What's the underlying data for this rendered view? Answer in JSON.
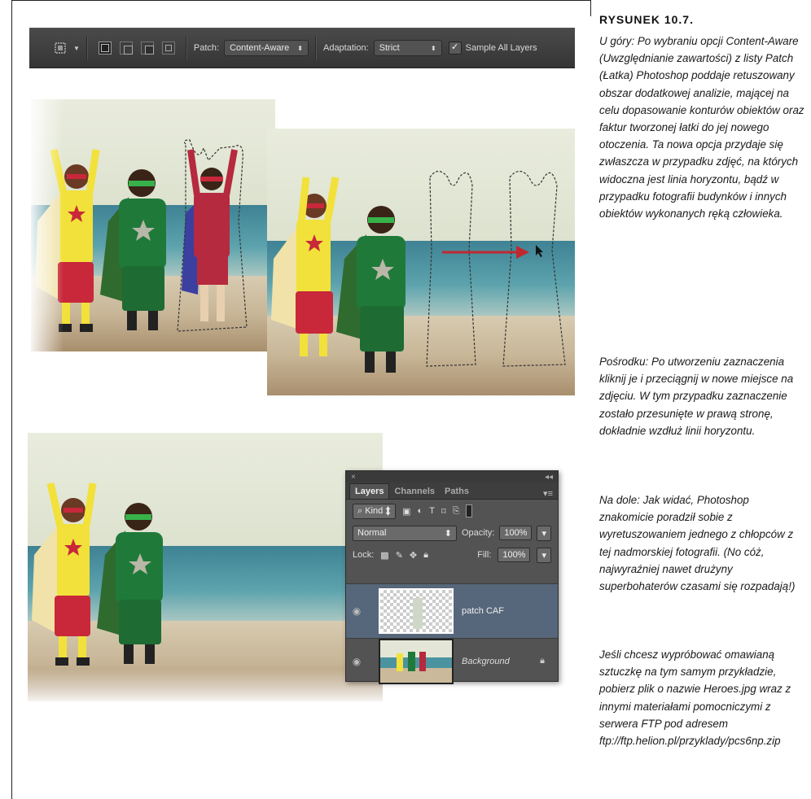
{
  "options_bar": {
    "tool_icon": "patch-tool-icon",
    "mode_icons": [
      "new-selection-icon",
      "add-to-selection-icon",
      "subtract-from-selection-icon",
      "intersect-selection-icon"
    ],
    "patch_label": "Patch:",
    "patch_value": "Content-Aware",
    "adaptation_label": "Adaptation:",
    "adaptation_value": "Strict",
    "sample_all_layers_label": "Sample All Layers",
    "sample_all_layers_checked": true
  },
  "layers_panel": {
    "close_glyph": "×",
    "collapse_glyph": "◂◂",
    "tabs": [
      "Layers",
      "Channels",
      "Paths"
    ],
    "filter_kind": "Kind",
    "blend_mode": "Normal",
    "opacity_label": "Opacity:",
    "opacity_value": "100%",
    "lock_label": "Lock:",
    "fill_label": "Fill:",
    "fill_value": "100%",
    "layers": [
      {
        "name": "patch CAF",
        "selected": true,
        "visible": true
      },
      {
        "name": "Background",
        "selected": false,
        "visible": true,
        "locked": true
      }
    ]
  },
  "caption": {
    "title": "RYSUNEK 10.7.",
    "paragraphs": [
      "U góry: Po wybraniu opcji Content-Aware (Uwzględnianie zawartości) z listy Patch (Łatka) Photoshop poddaje retuszowany obszar dodatkowej analizie, mającej na celu dopasowanie konturów obiektów oraz faktur tworzonej łatki do jej nowego otoczenia. Ta nowa opcja przydaje się zwłaszcza w przypadku zdjęć, na których widoczna jest linia horyzontu, bądź w przypadku fotografii budynków i innych obiektów wykonanych ręką człowieka.",
      "Pośrodku: Po utworzeniu zaznaczenia kliknij je i przeciągnij w nowe miejsce na zdjęciu. W tym przypadku zaznaczenie zostało przesunięte w prawą stronę, dokładnie wzdłuż linii horyzontu.",
      "Na dole: Jak widać, Photoshop znakomicie poradził sobie z wyretuszowaniem jednego z chłopców z tej nadmorskiej fotografii. (No cóż, najwyraźniej nawet drużyny superbohaterów czasami się rozpadają!)",
      "Jeśli chcesz wypróbować omawianą sztuczkę na tym samym przykładzie, pobierz plik o nazwie Heroes.jpg wraz z innymi materiałami pomocniczymi z serwera FTP pod adresem ftp://ftp.helion.pl/przyklady/pcs6np.zip"
    ]
  },
  "colors": {
    "arrow": "#c0282f",
    "panel_bg": "#535353",
    "selected_layer": "#57677b",
    "girl_top": "#f2e13a",
    "girl_shorts": "#c8283a",
    "boy_suit": "#1f7a3a",
    "boy3_suit": "#b52a3e"
  }
}
